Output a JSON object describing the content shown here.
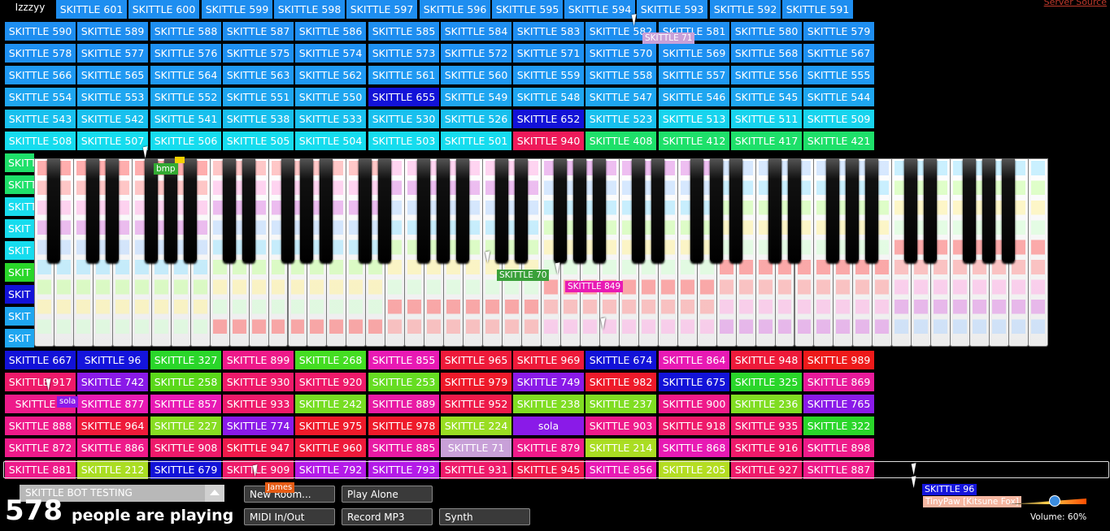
{
  "top_left_label": "Izzzyy",
  "server_link": "Server Source",
  "participants": {
    "rows": [
      [
        {
          "name": "SKITTLE 601",
          "color": "#1e8ef0"
        },
        {
          "name": "SKITTLE 600",
          "color": "#1e8ef0"
        },
        {
          "name": "SKITTLE 599",
          "color": "#1e8ef0"
        },
        {
          "name": "SKITTLE 598",
          "color": "#1e8ef0"
        },
        {
          "name": "SKITTLE 597",
          "color": "#1e8ef0"
        },
        {
          "name": "SKITTLE 596",
          "color": "#1e8ef0"
        },
        {
          "name": "SKITTLE 595",
          "color": "#1e8ef0"
        },
        {
          "name": "SKITTLE 594",
          "color": "#1e8ef0"
        },
        {
          "name": "SKITTLE 593",
          "color": "#1e8ef0"
        },
        {
          "name": "SKITTLE 592",
          "color": "#1e8ef0"
        },
        {
          "name": "SKITTLE 591",
          "color": "#1e8ef0"
        }
      ],
      [
        {
          "name": "SKITTLE 590",
          "color": "#1e8ef0"
        },
        {
          "name": "SKITTLE 589",
          "color": "#1e8ef0"
        },
        {
          "name": "SKITTLE 588",
          "color": "#1e8ef0"
        },
        {
          "name": "SKITTLE 587",
          "color": "#1e8ef0"
        },
        {
          "name": "SKITTLE 586",
          "color": "#1e8ef0"
        },
        {
          "name": "SKITTLE 585",
          "color": "#1e8ef0"
        },
        {
          "name": "SKITTLE 584",
          "color": "#1e8ef0"
        },
        {
          "name": "SKITTLE 583",
          "color": "#1e8ef0"
        },
        {
          "name": "SKITTLE 582",
          "color": "#1e8ef0"
        },
        {
          "name": "SKITTLE 581",
          "color": "#1e8ef0"
        },
        {
          "name": "SKITTLE 580",
          "color": "#1e8ef0"
        },
        {
          "name": "SKITTLE 579",
          "color": "#1e8ef0"
        }
      ],
      [
        {
          "name": "SKITTLE 578",
          "color": "#1e90f2"
        },
        {
          "name": "SKITTLE 577",
          "color": "#1e90f2"
        },
        {
          "name": "SKITTLE 576",
          "color": "#1e90f2"
        },
        {
          "name": "SKITTLE 575",
          "color": "#1e90f2"
        },
        {
          "name": "SKITTLE 574",
          "color": "#1e90f2"
        },
        {
          "name": "SKITTLE 573",
          "color": "#1e90f2"
        },
        {
          "name": "SKITTLE 572",
          "color": "#1e90f2"
        },
        {
          "name": "SKITTLE 571",
          "color": "#1e90f2"
        },
        {
          "name": "SKITTLE 570",
          "color": "#1e90f2"
        },
        {
          "name": "SKITTLE 569",
          "color": "#1e90f2"
        },
        {
          "name": "SKITTLE 568",
          "color": "#1e90f2"
        },
        {
          "name": "SKITTLE 567",
          "color": "#1e90f2"
        }
      ],
      [
        {
          "name": "SKITTLE 566",
          "color": "#1f99f2"
        },
        {
          "name": "SKITTLE 565",
          "color": "#1f99f2"
        },
        {
          "name": "SKITTLE 564",
          "color": "#1f99f2"
        },
        {
          "name": "SKITTLE 563",
          "color": "#1f99f2"
        },
        {
          "name": "SKITTLE 562",
          "color": "#1f99f2"
        },
        {
          "name": "SKITTLE 561",
          "color": "#1f99f2"
        },
        {
          "name": "SKITTLE 560",
          "color": "#1f99f2"
        },
        {
          "name": "SKITTLE 559",
          "color": "#1f99f2"
        },
        {
          "name": "SKITTLE 558",
          "color": "#1f99f2"
        },
        {
          "name": "SKITTLE 557",
          "color": "#1f99f2"
        },
        {
          "name": "SKITTLE 556",
          "color": "#1f99f2"
        },
        {
          "name": "SKITTLE 555",
          "color": "#1f99f2"
        }
      ],
      [
        {
          "name": "SKITTLE 554",
          "color": "#1ea6f0"
        },
        {
          "name": "SKITTLE 553",
          "color": "#1ea6f0"
        },
        {
          "name": "SKITTLE 552",
          "color": "#1ea6f0"
        },
        {
          "name": "SKITTLE 551",
          "color": "#1ea6f0"
        },
        {
          "name": "SKITTLE 550",
          "color": "#1ea6f0"
        },
        {
          "name": "SKITTLE 655",
          "color": "#1212d8"
        },
        {
          "name": "SKITTLE 549",
          "color": "#1ea6f0"
        },
        {
          "name": "SKITTLE 548",
          "color": "#1ea6f0"
        },
        {
          "name": "SKITTLE 547",
          "color": "#1ea6f0"
        },
        {
          "name": "SKITTLE 546",
          "color": "#1ea6f0"
        },
        {
          "name": "SKITTLE 545",
          "color": "#1ea6f0"
        },
        {
          "name": "SKITTLE 544",
          "color": "#1ea6f0"
        }
      ],
      [
        {
          "name": "SKITTLE 543",
          "color": "#18c0ee"
        },
        {
          "name": "SKITTLE 542",
          "color": "#18c0ee"
        },
        {
          "name": "SKITTLE 541",
          "color": "#18c0ee"
        },
        {
          "name": "SKITTLE 538",
          "color": "#18c0ee"
        },
        {
          "name": "SKITTLE 533",
          "color": "#18c0ee"
        },
        {
          "name": "SKITTLE 530",
          "color": "#18c0ee"
        },
        {
          "name": "SKITTLE 526",
          "color": "#18c0ee"
        },
        {
          "name": "SKITTLE 652",
          "color": "#1212d8"
        },
        {
          "name": "SKITTLE 523",
          "color": "#18c0ee"
        },
        {
          "name": "SKITTLE 513",
          "color": "#18d4ee"
        },
        {
          "name": "SKITTLE 511",
          "color": "#18d4ee"
        },
        {
          "name": "SKITTLE 509",
          "color": "#18d4ee"
        }
      ],
      [
        {
          "name": "SKITTLE 508",
          "color": "#16dcee"
        },
        {
          "name": "SKITTLE 507",
          "color": "#16dcee"
        },
        {
          "name": "SKITTLE 506",
          "color": "#16dcee"
        },
        {
          "name": "SKITTLE 505",
          "color": "#16dcee"
        },
        {
          "name": "SKITTLE 504",
          "color": "#16dcee"
        },
        {
          "name": "SKITTLE 503",
          "color": "#16dcee"
        },
        {
          "name": "SKITTLE 501",
          "color": "#16dcee"
        },
        {
          "name": "SKITTLE 940",
          "color": "#ee1a5a"
        },
        {
          "name": "SKITTLE 408",
          "color": "#1ee06a"
        },
        {
          "name": "SKITTLE 412",
          "color": "#1ee06a"
        },
        {
          "name": "SKITTLE 417",
          "color": "#1ee06a"
        },
        {
          "name": "SKITTLE 421",
          "color": "#1ee06a"
        }
      ],
      [
        {
          "name": "SKITTLE 667",
          "color": "#1212d8"
        },
        {
          "name": "SKITTLE 96",
          "color": "#1414dc"
        },
        {
          "name": "SKITTLE 327",
          "color": "#2ad62a"
        },
        {
          "name": "SKITTLE 899",
          "color": "#ee1a8a"
        },
        {
          "name": "SKITTLE 268",
          "color": "#44dd22"
        },
        {
          "name": "SKITTLE 855",
          "color": "#e81ab4"
        },
        {
          "name": "SKITTLE 965",
          "color": "#ee1a3a"
        },
        {
          "name": "SKITTLE 969",
          "color": "#ee1a3a"
        },
        {
          "name": "SKITTLE 674",
          "color": "#1212d8"
        },
        {
          "name": "SKITTLE 864",
          "color": "#e81ab4"
        },
        {
          "name": "SKITTLE 948",
          "color": "#ee1a3a"
        },
        {
          "name": "SKITTLE 989",
          "color": "#ee1a1a"
        }
      ],
      [
        {
          "name": "SKITTLE 917",
          "color": "#ee1a6a"
        },
        {
          "name": "SKITTLE 742",
          "color": "#8a1ae8"
        },
        {
          "name": "SKITTLE 258",
          "color": "#5ad81a"
        },
        {
          "name": "SKITTLE 930",
          "color": "#ee1a6a"
        },
        {
          "name": "SKITTLE 920",
          "color": "#ee1a6a"
        },
        {
          "name": "SKITTLE 253",
          "color": "#66dd22"
        },
        {
          "name": "SKITTLE 979",
          "color": "#ee1a2a"
        },
        {
          "name": "SKITTLE 749",
          "color": "#8a1ae8"
        },
        {
          "name": "SKITTLE 982",
          "color": "#ee1a2a"
        },
        {
          "name": "SKITTLE 675",
          "color": "#1212d8"
        },
        {
          "name": "SKITTLE 325",
          "color": "#2ad62a"
        },
        {
          "name": "SKITTLE 869",
          "color": "#e81a9a"
        }
      ],
      [
        {
          "name": "SKITTLE 9",
          "color": "#ee1a8a"
        },
        {
          "name": "SKITTLE 877",
          "color": "#e81ab4"
        },
        {
          "name": "SKITTLE 857",
          "color": "#e81ab4"
        },
        {
          "name": "SKITTLE 933",
          "color": "#ee1a6a"
        },
        {
          "name": "SKITTLE 242",
          "color": "#77dd22"
        },
        {
          "name": "SKITTLE 889",
          "color": "#e81aa4"
        },
        {
          "name": "SKITTLE 952",
          "color": "#ee1a4a"
        },
        {
          "name": "SKITTLE 238",
          "color": "#80dd22"
        },
        {
          "name": "SKITTLE 237",
          "color": "#80dd22"
        },
        {
          "name": "SKITTLE 900",
          "color": "#ee1a8a"
        },
        {
          "name": "SKITTLE 236",
          "color": "#80dd22"
        },
        {
          "name": "SKITTLE 765",
          "color": "#8a1ae8"
        }
      ],
      [
        {
          "name": "SKITTLE 888",
          "color": "#ee1a8a"
        },
        {
          "name": "SKITTLE 964",
          "color": "#ee1a3a"
        },
        {
          "name": "SKITTLE 227",
          "color": "#88dd22"
        },
        {
          "name": "SKITTLE 774",
          "color": "#8a1ae8"
        },
        {
          "name": "SKITTLE 975",
          "color": "#ee1a2a"
        },
        {
          "name": "SKITTLE 978",
          "color": "#ee1a2a"
        },
        {
          "name": "SKITTLE 224",
          "color": "#99dd22"
        },
        {
          "name": "sola",
          "color": "#8a1ae8"
        },
        {
          "name": "SKITTLE 903",
          "color": "#ee1a8a"
        },
        {
          "name": "SKITTLE 918",
          "color": "#ee1a6a"
        },
        {
          "name": "SKITTLE 935",
          "color": "#ee1a6a"
        },
        {
          "name": "SKITTLE 322",
          "color": "#2ad62a"
        }
      ],
      [
        {
          "name": "SKITTLE 872",
          "color": "#ee1a8a"
        },
        {
          "name": "SKITTLE 886",
          "color": "#ee1a8a"
        },
        {
          "name": "SKITTLE 908",
          "color": "#ee1a6a"
        },
        {
          "name": "SKITTLE 947",
          "color": "#ee1a4a"
        },
        {
          "name": "SKITTLE 960",
          "color": "#ee1a3a"
        },
        {
          "name": "SKITTLE 885",
          "color": "#e81aa4"
        },
        {
          "name": "SKITTLE 71",
          "color": "#c8a0d8"
        },
        {
          "name": "SKITTLE 879",
          "color": "#ee1a8a"
        },
        {
          "name": "SKITTLE 214",
          "color": "#aadd22"
        },
        {
          "name": "SKITTLE 868",
          "color": "#e81ab4"
        },
        {
          "name": "SKITTLE 916",
          "color": "#ee1a6a"
        },
        {
          "name": "SKITTLE 898",
          "color": "#ee1a8a"
        }
      ],
      [
        {
          "name": "SKITTLE 881",
          "color": "#ee1a8a"
        },
        {
          "name": "SKITTLE 212",
          "color": "#aadd22"
        },
        {
          "name": "SKITTLE 679",
          "color": "#1212d8"
        },
        {
          "name": "SKITTLE 909",
          "color": "#ee1a6a"
        },
        {
          "name": "SKITTLE 792",
          "color": "#b41ae8"
        },
        {
          "name": "SKITTLE 793",
          "color": "#b41ae8"
        },
        {
          "name": "SKITTLE 931",
          "color": "#ee1a6a"
        },
        {
          "name": "SKITTLE 945",
          "color": "#ee1a4a"
        },
        {
          "name": "SKITTLE 856",
          "color": "#e81ab4"
        },
        {
          "name": "SKITTLE 205",
          "color": "#b4dd22"
        },
        {
          "name": "SKITTLE 927",
          "color": "#ee1a6a"
        },
        {
          "name": "SKITTLE 887",
          "color": "#ee1a8a"
        }
      ]
    ],
    "partial_left": [
      "SKITT",
      "SKITT",
      "SKITT",
      "SKIT",
      "SKIT",
      "SKIT",
      "SKIT",
      "SKIT",
      "SKIT"
    ]
  },
  "piano_tags": {
    "bmp": "bmp",
    "skittle70": "SKITTLE 70",
    "skittle849": "SKITTLE 849",
    "skittle71": "SKITTLE 71",
    "sola_small": "sola"
  },
  "piano": {
    "white_keys": 52
  },
  "bottom": {
    "room_name": "SKITTLE BOT TESTING",
    "player_count": "578",
    "player_label": "people are playing",
    "buttons": {
      "new_room": "New Room...",
      "play_alone": "Play Alone",
      "midi": "MIDI In/Out",
      "record": "Record MP3",
      "synth": "Synth"
    },
    "james_tag": "James",
    "skittle96_tag": "SKITTLE 96",
    "tinypaw_tag": "TinyPaw [Kitsune Fox]",
    "volume_label": "Volume: 60%",
    "volume": 0.6
  }
}
